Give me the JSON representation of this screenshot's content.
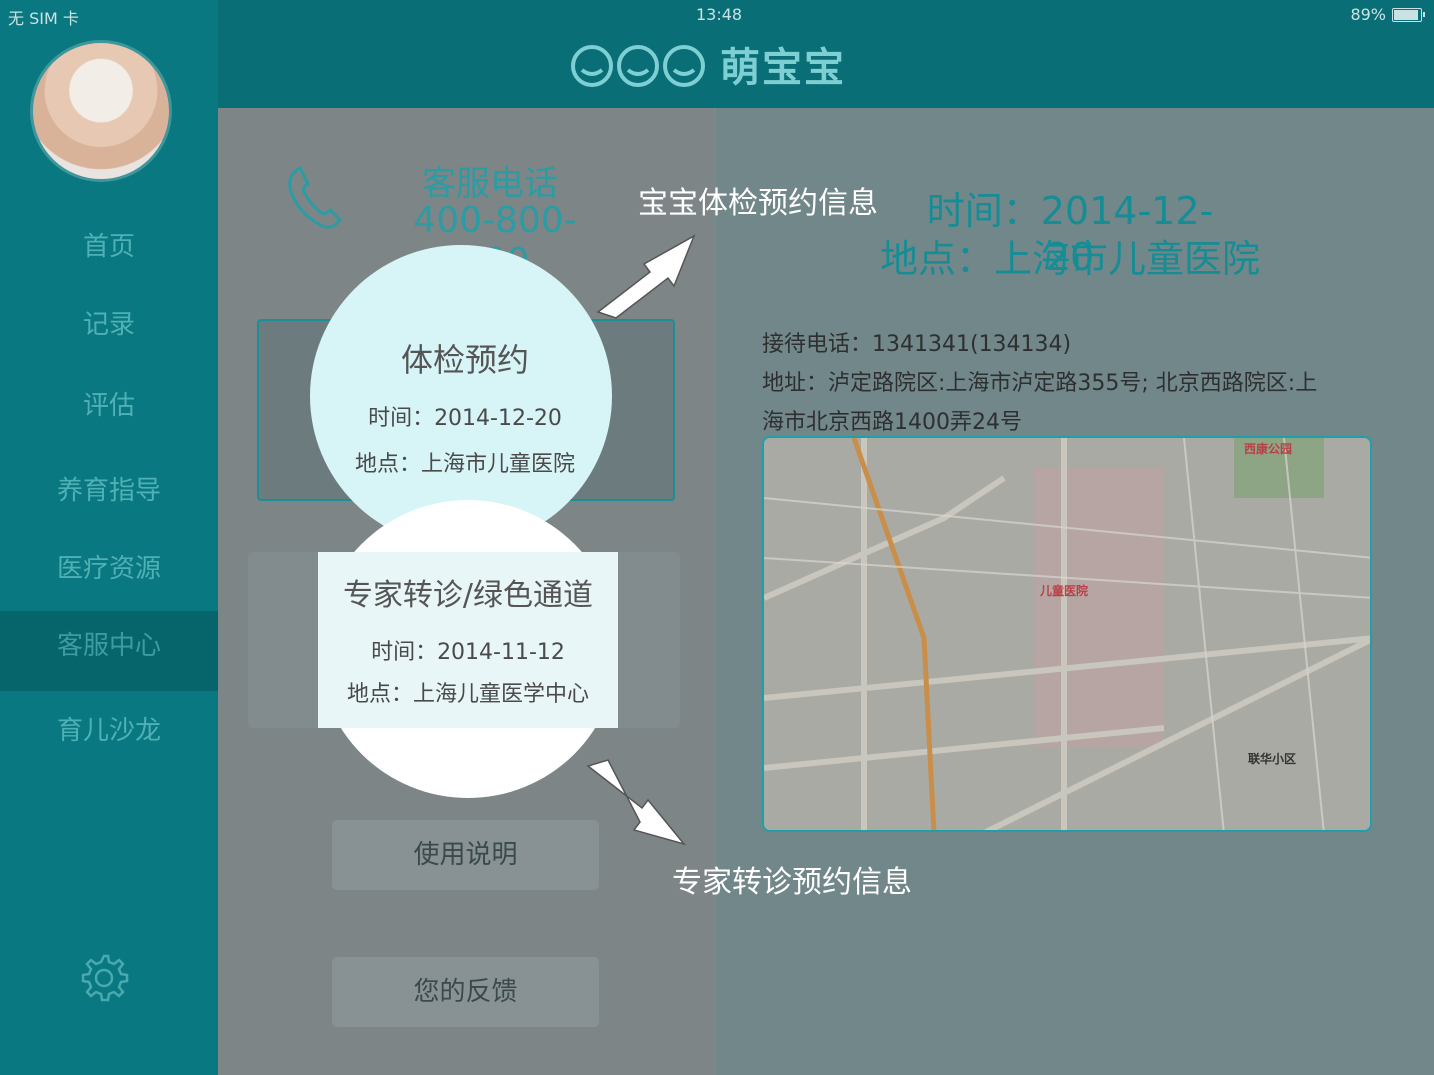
{
  "status": {
    "carrier": "无 SIM 卡",
    "time": "13:48",
    "battery": "89%"
  },
  "app": {
    "brand_text": "萌宝宝"
  },
  "sidebar": {
    "items": [
      {
        "label": "首页"
      },
      {
        "label": "记录"
      },
      {
        "label": "评估"
      },
      {
        "label": "养育指导"
      },
      {
        "label": "医疗资源"
      },
      {
        "label": "客服中心",
        "active": true
      },
      {
        "label": "育儿沙龙"
      }
    ]
  },
  "service": {
    "label": "客服电话",
    "number": "400-800-400"
  },
  "cards": [
    {
      "title": "体检预约",
      "time": "时间：2014-12-20",
      "place": "地点：上海市儿童医院"
    },
    {
      "title": "专家转诊/绿色通道",
      "time": "时间：2014-11-12",
      "place": "地点：上海儿童医学中心"
    }
  ],
  "buttons": {
    "manual": "使用说明",
    "feedback": "您的反馈"
  },
  "callouts": {
    "checkup": "宝宝体检预约信息",
    "referral": "专家转诊预约信息"
  },
  "detail": {
    "time": "时间：2014-12-20",
    "place": "地点：上海市儿童医院",
    "phone": "接待电话：1341341(134134)",
    "address_line1": "地址：泸定路院区:上海市泸定路355号; 北京西路院区:上",
    "address_line2": "海市北京西路1400弄24号"
  },
  "map": {
    "labels": {
      "hospital": "儿童医院",
      "park": "西康公园",
      "district": "联华小区"
    }
  },
  "colors": {
    "sidebar": "#0a7880",
    "accent": "#168c95",
    "header": "#0a6e76"
  },
  "icons": {
    "phone": "phone-icon",
    "settings": "gear-icon",
    "arrow": "arrow-icon"
  }
}
